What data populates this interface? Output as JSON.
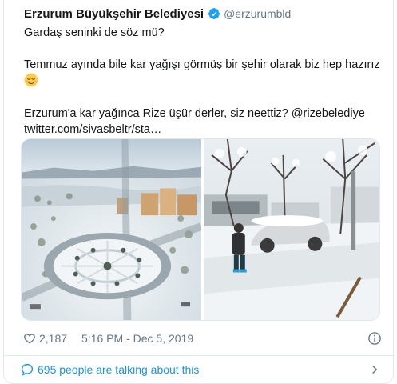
{
  "tweet": {
    "display_name": "Erzurum Büyükşehir Belediyesi",
    "handle": "@erzurumbld",
    "verified_icon": "verified-badge-icon",
    "lines": {
      "l1": "Gardaş seninki de söz mü?",
      "l2": "Temmuz ayında bile kar yağışı görmüş bir şehir olarak biz hep hazırız",
      "l3": "Erzurum'a kar yağınca Rize üşür derler, siz neettiz? @rizebelediye",
      "l4": "twitter.com/sivasbeltr/sta…"
    },
    "emoji_icon": "relieved-face-emoji",
    "media": [
      {
        "icon": "snowy-aerial-roundabout-photo"
      },
      {
        "icon": "snowy-street-shoveling-photo"
      }
    ]
  },
  "meta": {
    "likes": "2,187",
    "time": "5:16 PM - Dec 5, 2019",
    "heart_icon": "heart-icon",
    "info_icon": "info-icon"
  },
  "footer": {
    "talking_label": "695 people are talking about this",
    "bubble_icon": "speech-bubble-icon",
    "chevron_icon": "chevron-right-icon"
  },
  "colors": {
    "link": "#1b95e0",
    "verified": "#1da1f2",
    "secondary_text": "#657786",
    "border": "#e1e8ed"
  }
}
